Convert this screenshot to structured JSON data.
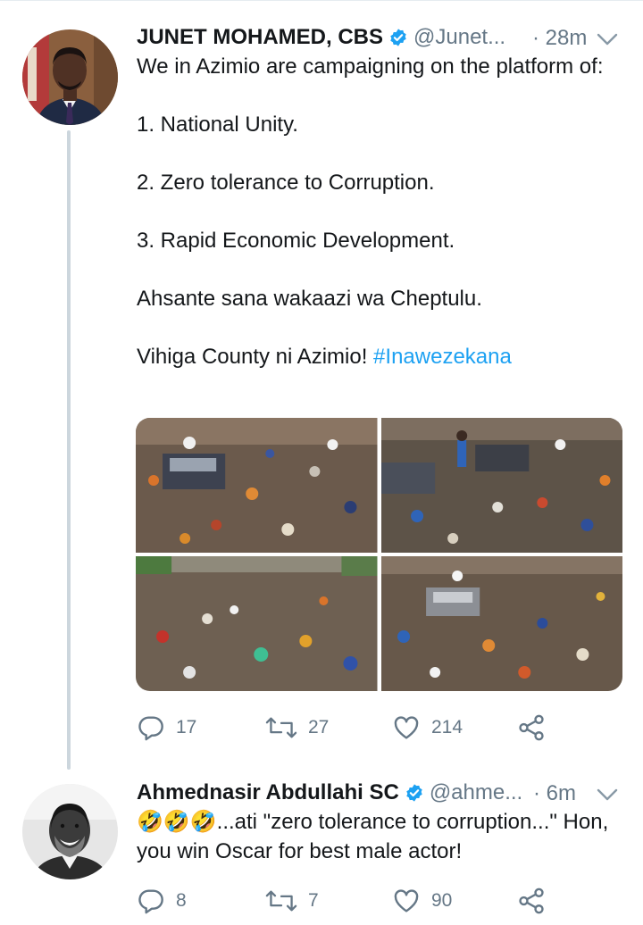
{
  "colors": {
    "accent": "#1da1f2",
    "muted": "#657786",
    "text": "#14171a",
    "thread": "#ccd6dd",
    "like": "#657786"
  },
  "tweets": [
    {
      "name": "JUNET MOHAMED, CBS",
      "handle": "@Junet...",
      "time": "· 28m",
      "verified": true,
      "body": {
        "intro": "We in Azimio are campaigning on the platform of:",
        "point1": "1. National Unity.",
        "point2": "2. Zero tolerance to Corruption.",
        "point3": "3. Rapid Economic Development.",
        "thanks": "Ahsante sana wakaazi wa Cheptulu.",
        "closing": "Vihiga County ni Azimio!",
        "hashtag": "#Inawezekana"
      },
      "media_count": 4,
      "stats": {
        "replies": "17",
        "retweets": "27",
        "likes": "214"
      },
      "icons": [
        "reply-icon",
        "retweet-icon",
        "like-icon",
        "share-icon"
      ]
    },
    {
      "name": "Ahmednasir Abdullahi SC",
      "handle": "@ahme...",
      "time": "· 6m",
      "verified": true,
      "body": {
        "emoji": "🤣🤣🤣",
        "text": "...ati \"zero tolerance to corruption...\" Hon, you win Oscar for best male actor!"
      },
      "stats": {
        "replies": "8",
        "retweets": "7",
        "likes": "90"
      },
      "icons": [
        "reply-icon",
        "retweet-icon",
        "like-icon",
        "share-icon"
      ]
    }
  ]
}
